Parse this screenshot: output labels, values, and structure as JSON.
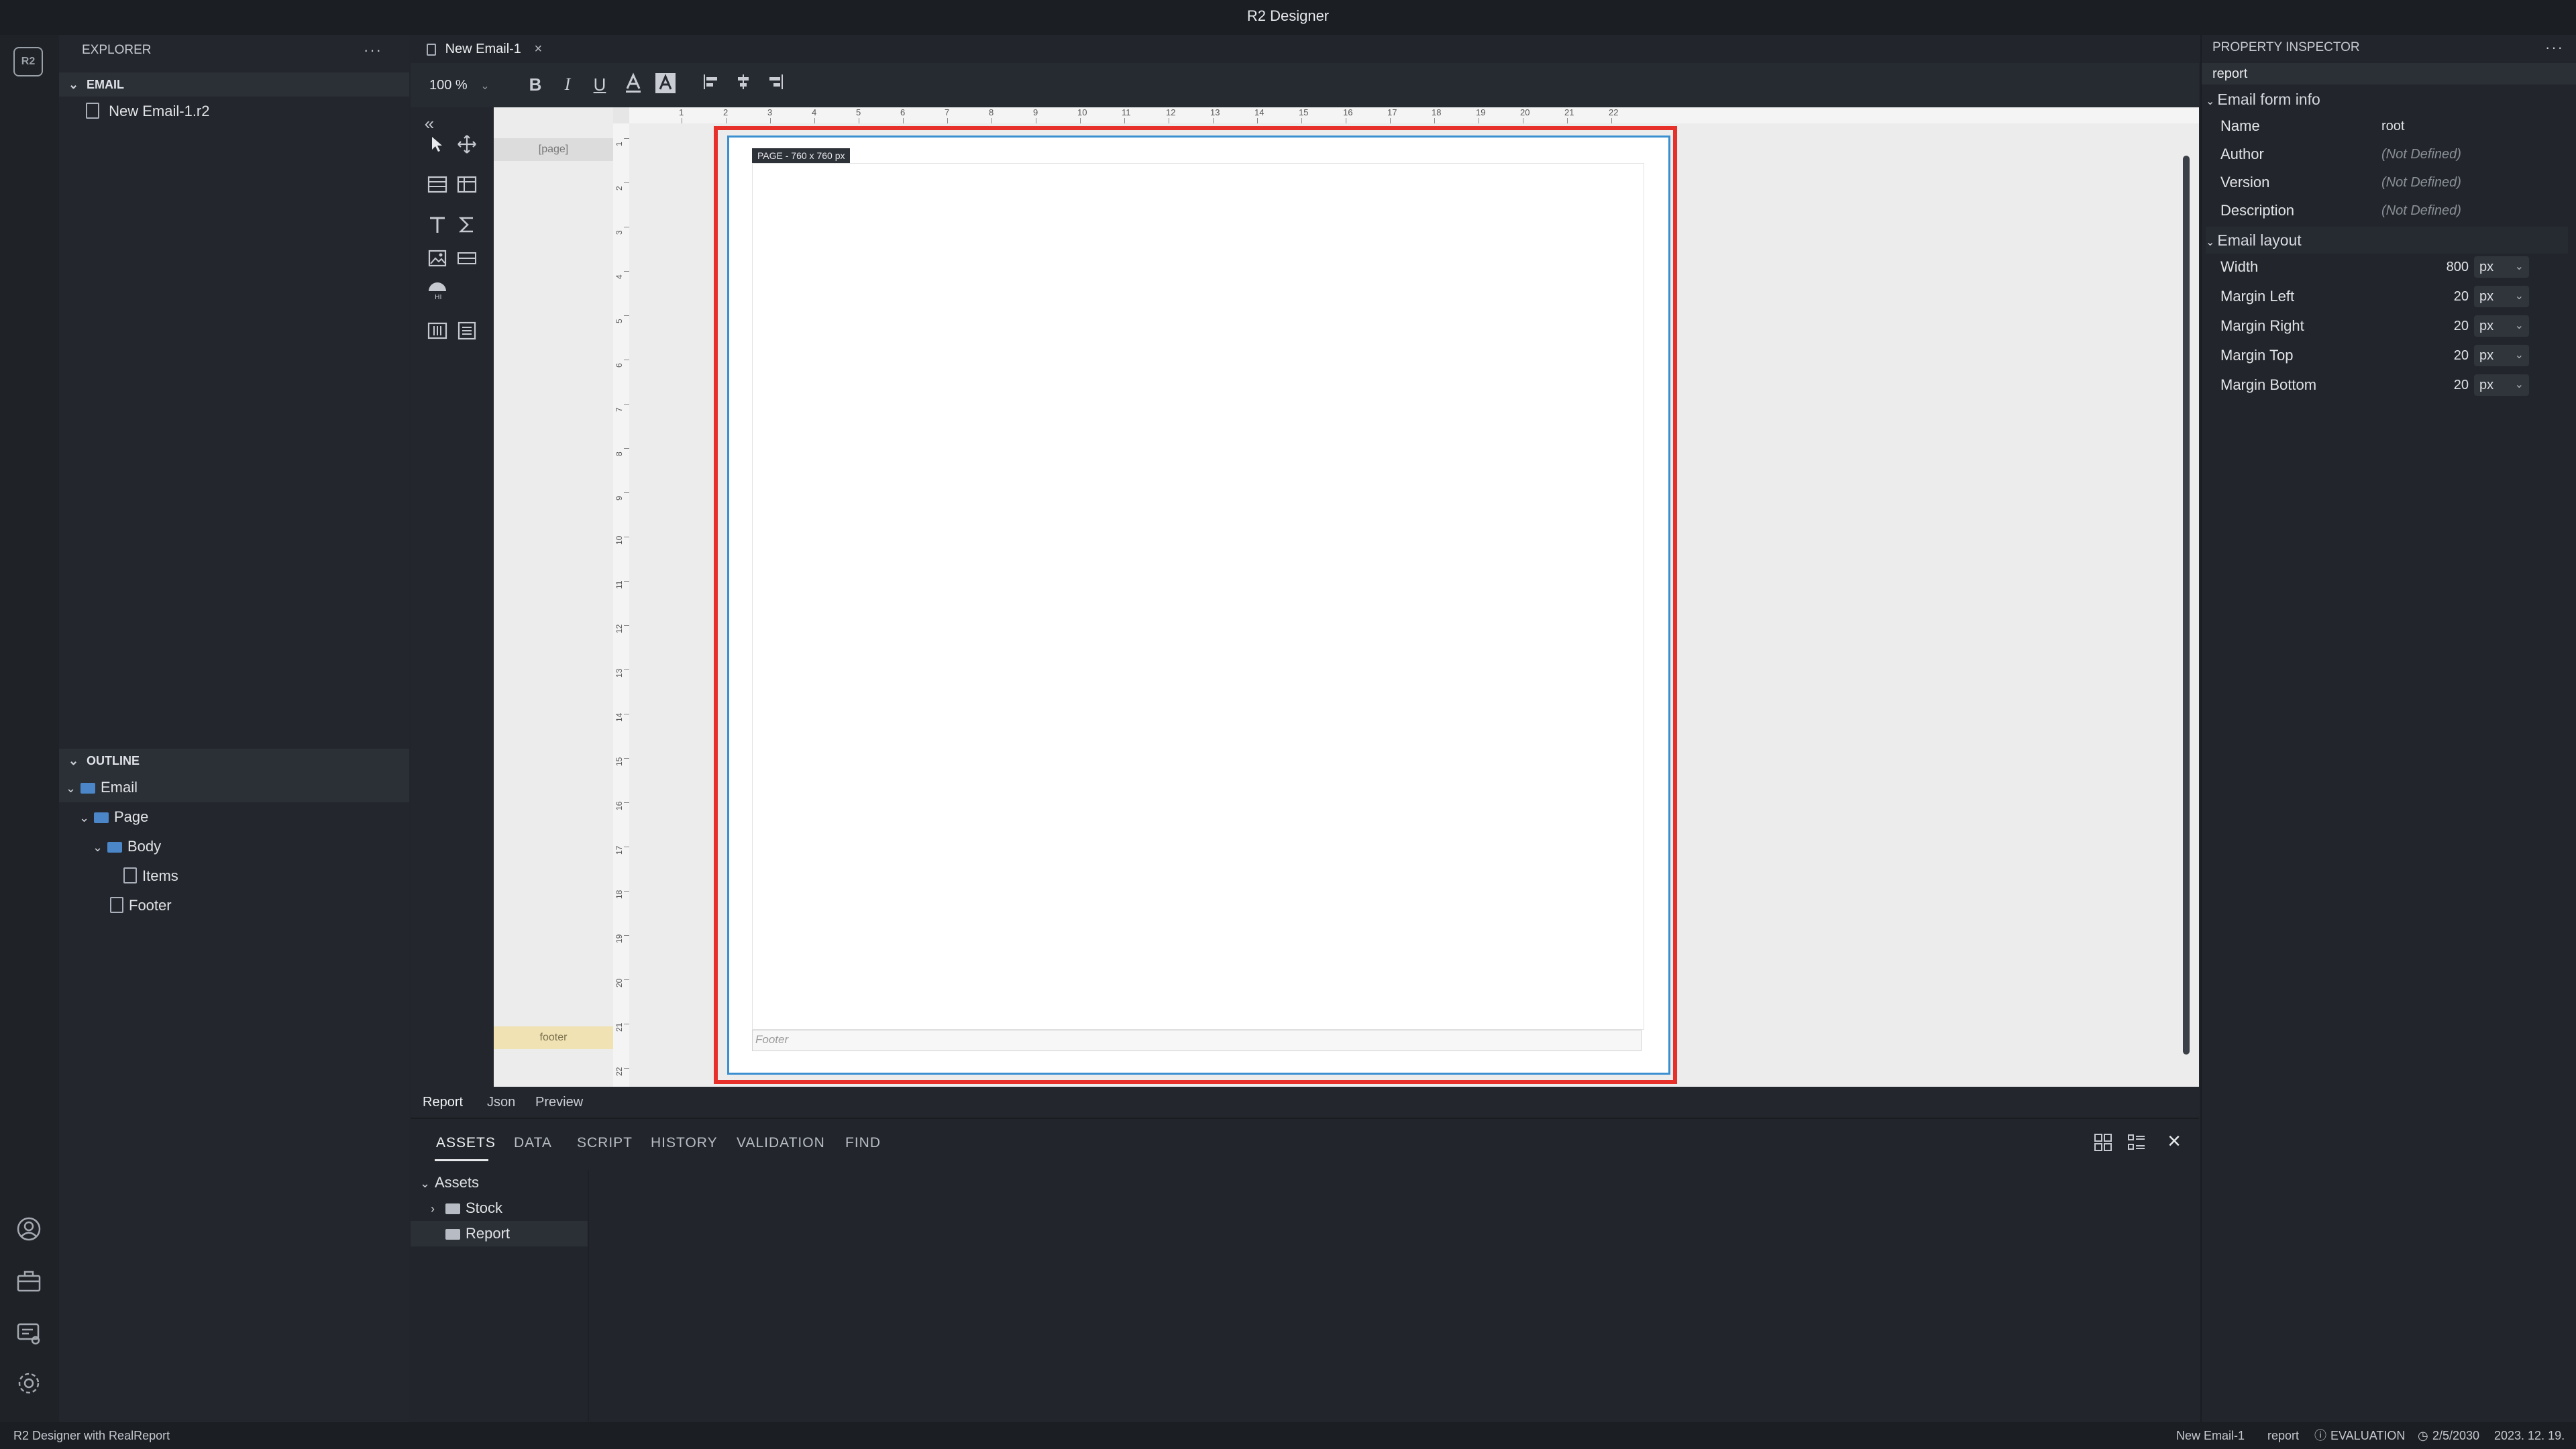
{
  "window": {
    "title": "R2 Designer"
  },
  "explorer": {
    "header": "EXPLORER",
    "more": "···",
    "section": "EMAIL",
    "files": [
      {
        "name": "New Email-1.r2"
      }
    ]
  },
  "outline": {
    "header": "OUTLINE",
    "items": [
      {
        "label": "Email"
      },
      {
        "label": "Page"
      },
      {
        "label": "Body"
      },
      {
        "label": "Items"
      },
      {
        "label": "Footer"
      }
    ]
  },
  "editor": {
    "tab": {
      "label": "New Email-1",
      "close": "×"
    },
    "toolbar": {
      "zoom": "100 %",
      "bold": "B",
      "italic": "I",
      "underline": "U"
    },
    "collapse_icon": "«",
    "band_labels": {
      "page": "[page]",
      "footer": "footer"
    },
    "page_badge": "PAGE - 760 x 760 px",
    "footer_placeholder": "Footer",
    "ruler_h": [
      "1",
      "2",
      "3",
      "4",
      "5",
      "6",
      "7",
      "8",
      "9",
      "10",
      "11",
      "12",
      "13",
      "14",
      "15",
      "16",
      "17",
      "18",
      "19",
      "20",
      "21",
      "22"
    ],
    "ruler_v": [
      "1",
      "2",
      "3",
      "4",
      "5",
      "6",
      "7",
      "8",
      "9",
      "10",
      "11",
      "12",
      "13",
      "14",
      "15",
      "16",
      "17",
      "18",
      "19",
      "20",
      "21",
      "22"
    ]
  },
  "bottom_tabs": [
    "Report",
    "Json",
    "Preview"
  ],
  "assets_panel": {
    "tabs": [
      "ASSETS",
      "DATA",
      "SCRIPT",
      "HISTORY",
      "VALIDATION",
      "FIND"
    ],
    "tree": [
      {
        "label": "Assets"
      },
      {
        "label": "Stock"
      },
      {
        "label": "Report"
      }
    ],
    "close": "×"
  },
  "inspector": {
    "header": "PROPERTY INSPECTOR",
    "more": "···",
    "target": "report",
    "groups": [
      {
        "label": "Email form info",
        "rows": [
          {
            "label": "Name",
            "value": "root"
          },
          {
            "label": "Author",
            "value": "(Not Defined)"
          },
          {
            "label": "Version",
            "value": "(Not Defined)"
          },
          {
            "label": "Description",
            "value": "(Not Defined)"
          }
        ]
      },
      {
        "label": "Email layout",
        "rows": [
          {
            "label": "Width",
            "value": "800",
            "unit": "px"
          },
          {
            "label": "Margin Left",
            "value": "20",
            "unit": "px"
          },
          {
            "label": "Margin Right",
            "value": "20",
            "unit": "px"
          },
          {
            "label": "Margin Top",
            "value": "20",
            "unit": "px"
          },
          {
            "label": "Margin Bottom",
            "value": "20",
            "unit": "px"
          }
        ]
      }
    ]
  },
  "statusbar": {
    "left": "R2 Designer with RealReport",
    "document": "New Email-1",
    "target": "report",
    "license": "EVALUATION",
    "expiry": "2/5/2030",
    "date": "2023. 12. 19."
  },
  "colors": {
    "highlight_border": "#e8302a",
    "page_border": "#3a8fd0",
    "app_bg": "#22262c",
    "canvas_bg": "#ececec"
  }
}
